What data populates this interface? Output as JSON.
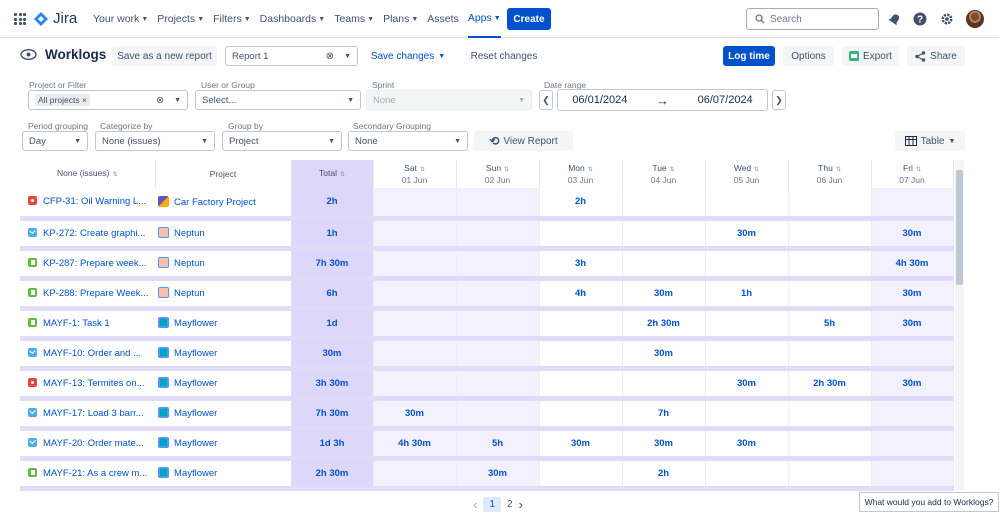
{
  "topnav": {
    "logo_text": "Jira",
    "items": [
      {
        "label": "Your work"
      },
      {
        "label": "Projects"
      },
      {
        "label": "Filters"
      },
      {
        "label": "Dashboards"
      },
      {
        "label": "Teams"
      },
      {
        "label": "Plans"
      },
      {
        "label": "Assets"
      },
      {
        "label": "Apps"
      }
    ],
    "create_label": "Create",
    "search_placeholder": "Search",
    "accent": "#0052cc"
  },
  "header": {
    "title": "Worklogs",
    "save_new_label": "Save as a new report",
    "report_name": "Report 1",
    "save_changes_label": "Save changes",
    "reset_label": "Reset changes",
    "log_time_label": "Log time",
    "options_label": "Options",
    "export_label": "Export",
    "share_label": "Share"
  },
  "filters": {
    "project_label": "Project or Filter",
    "project_tag": "All projects",
    "user_label": "User or Group",
    "user_placeholder": "Select...",
    "sprint_label": "Sprint",
    "sprint_value": "None",
    "date_label": "Date range",
    "date_from": "06/01/2024",
    "date_to": "06/07/2024",
    "period_label": "Period grouping",
    "period_value": "Day",
    "categorize_label": "Categorize by",
    "categorize_value": "None (issues)",
    "group_label": "Group by",
    "group_value": "Project",
    "secondary_label": "Secondary Grouping",
    "secondary_value": "None",
    "view_report_label": "View Report",
    "view_mode": "Table"
  },
  "table": {
    "columns": [
      {
        "label": "None (issues)",
        "sub": ""
      },
      {
        "label": "Project",
        "sub": ""
      },
      {
        "label": "Total",
        "sub": ""
      },
      {
        "label": "Sat",
        "sub": "01 Jun"
      },
      {
        "label": "Sun",
        "sub": "02 Jun"
      },
      {
        "label": "Mon",
        "sub": "03 Jun"
      },
      {
        "label": "Tue",
        "sub": "04 Jun"
      },
      {
        "label": "Wed",
        "sub": "05 Jun"
      },
      {
        "label": "Thu",
        "sub": "06 Jun"
      },
      {
        "label": "Fri",
        "sub": "07 Jun"
      }
    ],
    "rows": [
      {
        "type": "bug",
        "issue": "CFP-31: Oil Warning L...",
        "proj_icon": "car",
        "project": "Car Factory Project",
        "total": "2h",
        "days": [
          "",
          "",
          "2h",
          "",
          "",
          "",
          ""
        ]
      },
      {
        "type": "task",
        "issue": "KP-272: Create graphi...",
        "proj_icon": "nep",
        "project": "Neptun",
        "total": "1h",
        "days": [
          "",
          "",
          "",
          "",
          "30m",
          "",
          "30m"
        ]
      },
      {
        "type": "story",
        "issue": "KP-287: Prepare week...",
        "proj_icon": "nep",
        "project": "Neptun",
        "total": "7h 30m",
        "days": [
          "",
          "",
          "3h",
          "",
          "",
          "",
          "4h 30m"
        ]
      },
      {
        "type": "story",
        "issue": "KP-288: Prepare Week...",
        "proj_icon": "nep",
        "project": "Neptun",
        "total": "6h",
        "days": [
          "",
          "",
          "4h",
          "30m",
          "1h",
          "",
          "30m"
        ]
      },
      {
        "type": "story",
        "issue": "MAYF-1: Task 1",
        "proj_icon": "may",
        "project": "Mayflower",
        "total": "1d",
        "days": [
          "",
          "",
          "",
          "2h 30m",
          "",
          "5h",
          "30m"
        ]
      },
      {
        "type": "task",
        "issue": "MAYF-10: Order and ...",
        "proj_icon": "may",
        "project": "Mayflower",
        "total": "30m",
        "days": [
          "",
          "",
          "",
          "30m",
          "",
          "",
          ""
        ]
      },
      {
        "type": "bug",
        "issue": "MAYF-13: Termites on...",
        "proj_icon": "may",
        "project": "Mayflower",
        "total": "3h 30m",
        "days": [
          "",
          "",
          "",
          "",
          "30m",
          "2h 30m",
          "30m"
        ]
      },
      {
        "type": "task",
        "issue": "MAYF-17: Load 3 barr...",
        "proj_icon": "may",
        "project": "Mayflower",
        "total": "7h 30m",
        "days": [
          "30m",
          "",
          "",
          "7h",
          "",
          "",
          ""
        ]
      },
      {
        "type": "task",
        "issue": "MAYF-20: Order mate...",
        "proj_icon": "may",
        "project": "Mayflower",
        "total": "1d 3h",
        "days": [
          "4h 30m",
          "5h",
          "30m",
          "30m",
          "30m",
          "",
          ""
        ]
      },
      {
        "type": "story",
        "issue": "MAYF-21: As a crew m...",
        "proj_icon": "may",
        "project": "Mayflower",
        "total": "2h 30m",
        "days": [
          "",
          "30m",
          "",
          "2h",
          "",
          "",
          ""
        ]
      }
    ]
  },
  "pagination": {
    "prev": "‹",
    "pages": [
      "1",
      "2"
    ],
    "current": "1",
    "next": "›"
  },
  "feedback_text": "What would you add to Worklogs?"
}
